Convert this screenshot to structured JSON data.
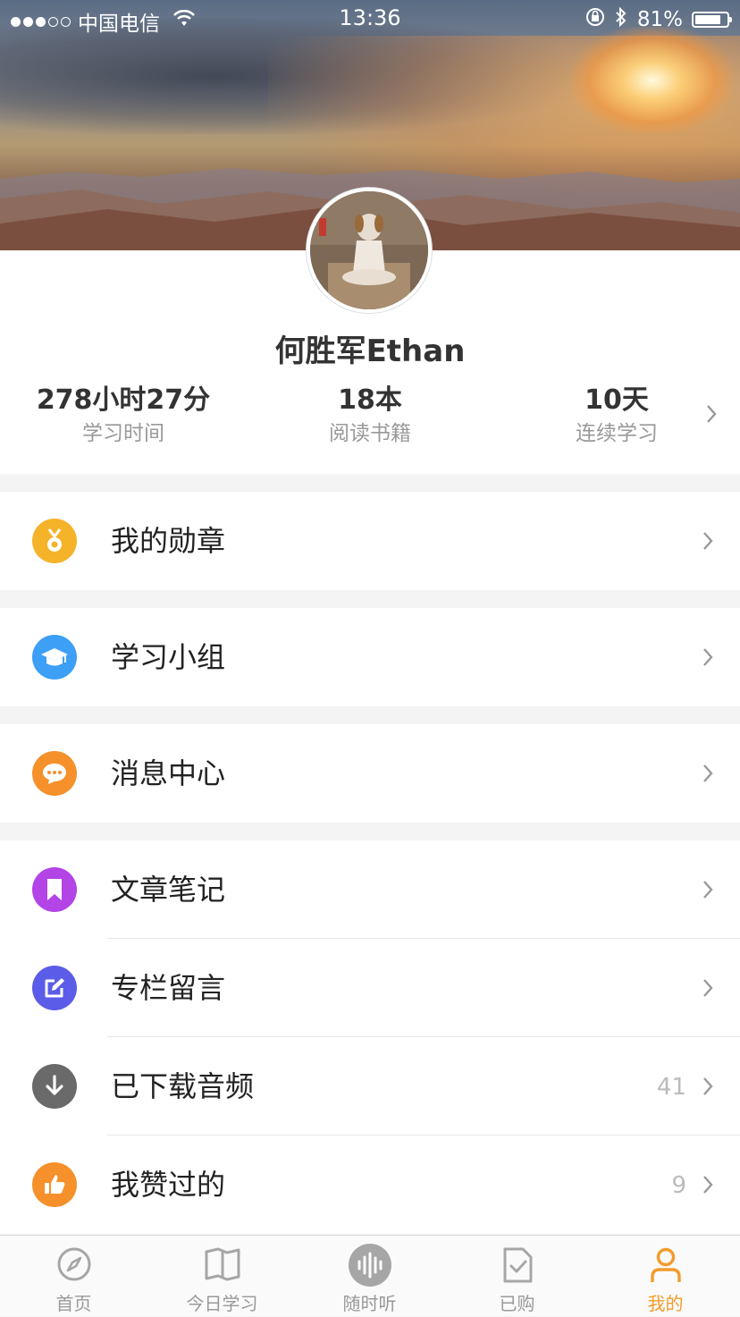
{
  "status_bar": {
    "carrier": "中国电信",
    "time": "13:36",
    "battery_text": "81%",
    "battery_level": 0.81
  },
  "profile": {
    "name": "何胜军Ethan",
    "stats": [
      {
        "value": "278小时27分",
        "label": "学习时间"
      },
      {
        "value": "18本",
        "label": "阅读书籍"
      },
      {
        "value": "10天",
        "label": "连续学习"
      }
    ]
  },
  "menu": {
    "badges": {
      "label": "我的勋章",
      "icon": "medal-icon",
      "color": "#f5b32a"
    },
    "study_group": {
      "label": "学习小组",
      "icon": "graduation-cap-icon",
      "color": "#3d9ff5"
    },
    "messages": {
      "label": "消息中心",
      "icon": "chat-bubble-icon",
      "color": "#f5902a"
    },
    "notes": {
      "label": "文章笔记",
      "icon": "bookmark-icon",
      "color": "#b344e6"
    },
    "comments": {
      "label": "专栏留言",
      "icon": "edit-icon",
      "color": "#5b5ce8"
    },
    "downloads": {
      "label": "已下载音频",
      "count": "41",
      "icon": "download-icon",
      "color": "#6a6a6a"
    },
    "liked": {
      "label": "我赞过的",
      "count": "9",
      "icon": "thumbs-up-icon",
      "color": "#f5902a"
    }
  },
  "tabbar": {
    "accent": "#f39c2b",
    "tabs": [
      {
        "label": "首页",
        "icon": "compass-icon"
      },
      {
        "label": "今日学习",
        "icon": "open-book-icon"
      },
      {
        "label": "随时听",
        "icon": "audio-wave-icon"
      },
      {
        "label": "已购",
        "icon": "purchased-doc-icon"
      },
      {
        "label": "我的",
        "icon": "person-icon",
        "active": true
      }
    ]
  }
}
